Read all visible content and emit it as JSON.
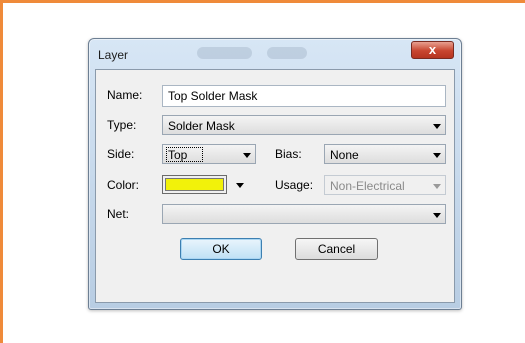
{
  "window": {
    "title": "Layer",
    "close_glyph": "x"
  },
  "form": {
    "name": {
      "label": "Name:",
      "value": "Top Solder Mask"
    },
    "type": {
      "label": "Type:",
      "value": "Solder Mask"
    },
    "side": {
      "label": "Side:",
      "value": "Top"
    },
    "bias": {
      "label": "Bias:",
      "value": "None"
    },
    "color": {
      "label": "Color:",
      "swatch_color": "#f2f20a"
    },
    "usage": {
      "label": "Usage:",
      "value": "Non-Electrical"
    },
    "net": {
      "label": "Net:",
      "value": ""
    }
  },
  "buttons": {
    "ok": "OK",
    "cancel": "Cancel"
  },
  "icons": {
    "close": "close-icon",
    "dropdown": "chevron-down-icon"
  },
  "colors": {
    "frame_accent": "#ef8a3a",
    "title_bar": "#c9dbef",
    "close_button": "#c8452f",
    "ok_button": "#bfe0f5"
  }
}
